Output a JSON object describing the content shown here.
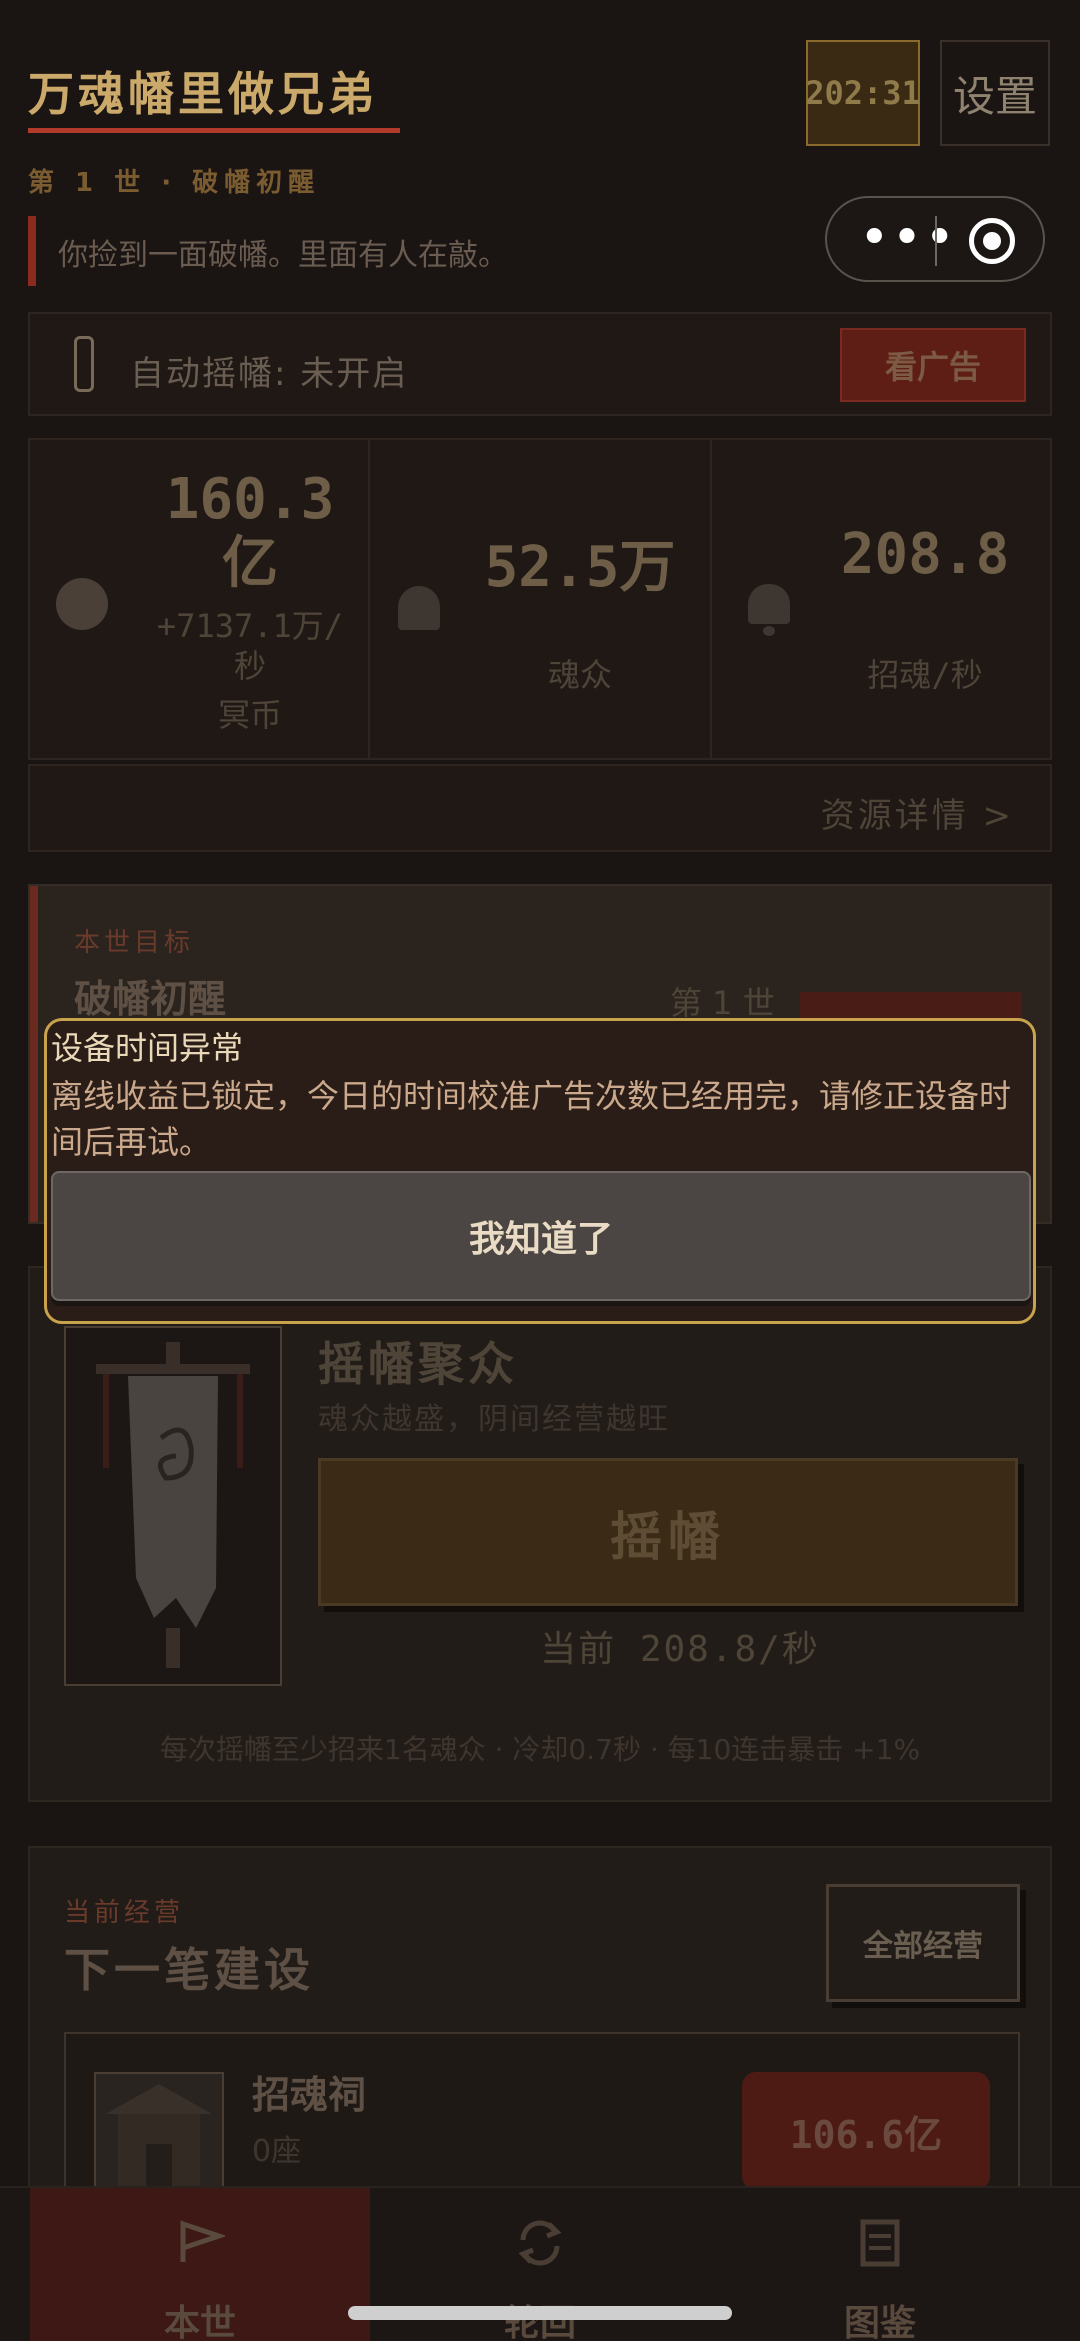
{
  "header": {
    "app_title": "万魂幡里做兄弟",
    "timer": "202:31",
    "settings_label": "设置",
    "generation": "第 1 世 · 破幡初醒",
    "story": "你捡到一面破幡。里面有人在敲。"
  },
  "auto": {
    "status": "自动摇幡: 未开启",
    "ad_label": "看广告"
  },
  "stats": {
    "coins": {
      "value_line1": "160.3",
      "value_line2": "亿",
      "rate_line1": "+7137.1万/",
      "rate_line2": "秒",
      "label": "冥币"
    },
    "souls": {
      "value": "52.5万",
      "label": "魂众"
    },
    "summon": {
      "value": "208.8",
      "label": "招魂/秒"
    },
    "details_link": "资源详情 >"
  },
  "goal": {
    "label": "本世目标",
    "title": "破幡初醒",
    "generation": "第 1 世"
  },
  "main": {
    "title": "摇幡聚众",
    "subtitle": "魂众越盛，阴间经营越旺",
    "shake_label": "摇幡",
    "rate": "当前 208.8/秒",
    "hint": "每次摇幡至少招来1名魂众 · 冷却0.7秒 · 每10连击暴击 +1%"
  },
  "build": {
    "label": "当前经营",
    "title": "下一笔建设",
    "all_label": "全部经营",
    "item_name": "招魂祠",
    "item_count": "0座",
    "price": "106.6亿"
  },
  "tabs": [
    {
      "label": "本世",
      "icon": "flag-icon"
    },
    {
      "label": "轮回",
      "icon": "cycle-icon"
    },
    {
      "label": "图鉴",
      "icon": "book-icon"
    }
  ],
  "modal": {
    "title": "设备时间异常",
    "message": "离线收益已锁定，今日的时间校准广告次数已经用完，请修正设备时间后再试。",
    "button": "我知道了"
  },
  "colors": {
    "accent_gold": "#c9a34c",
    "accent_red": "#b23a2a",
    "background": "#1a1412"
  }
}
